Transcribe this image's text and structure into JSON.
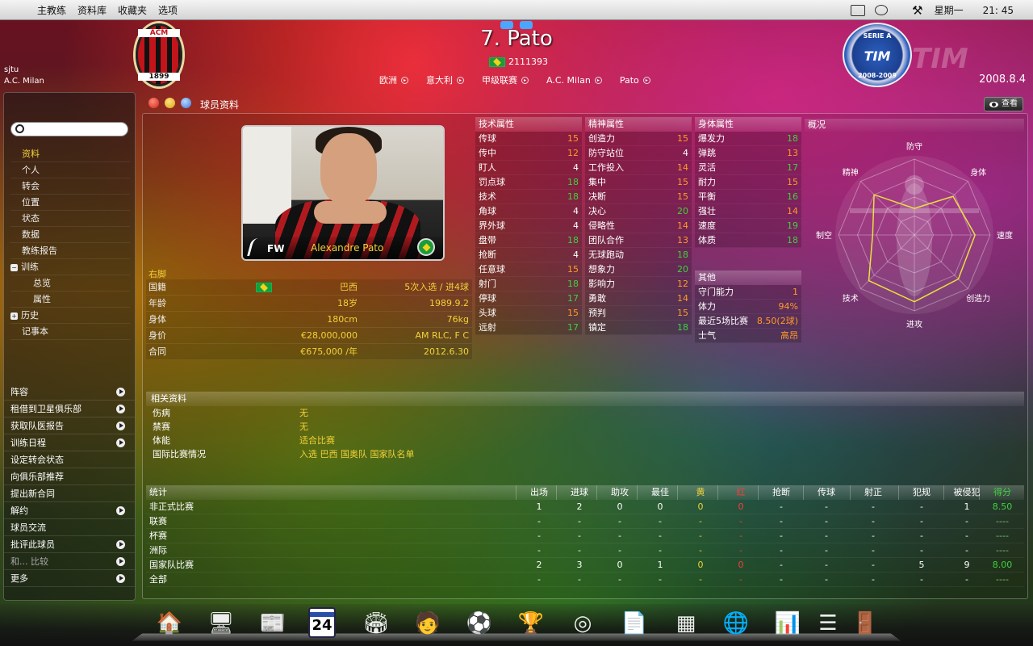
{
  "menubar": {
    "menus": [
      "主教练",
      "资料库",
      "收藏夹",
      "选项"
    ],
    "weekday": "星期一",
    "time": "21: 45"
  },
  "header": {
    "user": "sjtu",
    "club": "A.C. Milan",
    "club_logo": {
      "top": "ACM",
      "year": "1899"
    },
    "player_title": "7. Pato",
    "player_id": "2111393",
    "breadcrumbs": [
      "欧洲",
      "意大利",
      "甲级联赛",
      "A.C. Milan",
      "Pato"
    ],
    "league_logo": {
      "top": "SERIE A",
      "mid": "TIM",
      "season": "2008-2009"
    },
    "watermark": "TIM",
    "date": "2008.8.4"
  },
  "sidebar": {
    "nav": [
      {
        "label": "资料",
        "level": 1,
        "active": true
      },
      {
        "label": "个人",
        "level": 1
      },
      {
        "label": "转会",
        "level": 1
      },
      {
        "label": "位置",
        "level": 1
      },
      {
        "label": "状态",
        "level": 1
      },
      {
        "label": "数据",
        "level": 1
      },
      {
        "label": "教练报告",
        "level": 1
      },
      {
        "label": "训练",
        "level": 0,
        "toggle": "−"
      },
      {
        "label": "总览",
        "level": 2
      },
      {
        "label": "属性",
        "level": 2
      },
      {
        "label": "历史",
        "level": 0,
        "toggle": "+"
      },
      {
        "label": "记事本",
        "level": 1
      }
    ],
    "actions": [
      {
        "label": "阵容",
        "arrow": true
      },
      {
        "label": "租借到卫星俱乐部",
        "arrow": true
      },
      {
        "label": "获取队医报告",
        "arrow": true
      },
      {
        "label": "训练日程",
        "arrow": true
      },
      {
        "label": "设定转会状态",
        "arrow": false
      },
      {
        "label": "向俱乐部推荐",
        "arrow": false
      },
      {
        "label": "提出新合同",
        "arrow": false
      },
      {
        "label": "解约",
        "arrow": true
      },
      {
        "label": "球员交流",
        "arrow": false
      },
      {
        "label": "批评此球员",
        "arrow": true
      },
      {
        "label": "和... 比较",
        "arrow": true,
        "dim": true
      },
      {
        "label": "更多",
        "arrow": true
      }
    ]
  },
  "panel": {
    "title": "球员资料",
    "view_label": "查看"
  },
  "profile": {
    "position": "FW",
    "name": "Alexandre  Pato",
    "foot": "右脚",
    "bio": [
      {
        "label": "国籍",
        "flag": true,
        "mid": "巴西",
        "right": "5次入选 / 进4球"
      },
      {
        "label": "年龄",
        "mid": "18岁",
        "right": "1989.9.2"
      },
      {
        "label": "身体",
        "mid": "180cm",
        "right": "76kg"
      },
      {
        "label": "身价",
        "mid": "€28,000,000",
        "right": "AM RLC, F C"
      },
      {
        "label": "合同",
        "mid": "€675,000 /年",
        "right": "2012.6.30"
      }
    ]
  },
  "attributes": {
    "technical": {
      "title": "技术属性",
      "items": [
        {
          "name": "传球",
          "value": "15"
        },
        {
          "name": "传中",
          "value": "12"
        },
        {
          "name": "盯人",
          "value": "4"
        },
        {
          "name": "罚点球",
          "value": "18"
        },
        {
          "name": "技术",
          "value": "18"
        },
        {
          "name": "角球",
          "value": "4"
        },
        {
          "name": "界外球",
          "value": "4"
        },
        {
          "name": "盘带",
          "value": "18"
        },
        {
          "name": "抢断",
          "value": "4"
        },
        {
          "name": "任意球",
          "value": "15"
        },
        {
          "name": "射门",
          "value": "18"
        },
        {
          "name": "停球",
          "value": "17"
        },
        {
          "name": "头球",
          "value": "15"
        },
        {
          "name": "远射",
          "value": "17"
        }
      ]
    },
    "mental": {
      "title": "精神属性",
      "items": [
        {
          "name": "创造力",
          "value": "15"
        },
        {
          "name": "防守站位",
          "value": "4"
        },
        {
          "name": "工作投入",
          "value": "14"
        },
        {
          "name": "集中",
          "value": "15"
        },
        {
          "name": "决断",
          "value": "15"
        },
        {
          "name": "决心",
          "value": "20"
        },
        {
          "name": "侵略性",
          "value": "14"
        },
        {
          "name": "团队合作",
          "value": "13"
        },
        {
          "name": "无球跑动",
          "value": "18"
        },
        {
          "name": "想象力",
          "value": "20"
        },
        {
          "name": "影响力",
          "value": "12"
        },
        {
          "name": "勇敢",
          "value": "14"
        },
        {
          "name": "预判",
          "value": "15"
        },
        {
          "name": "镇定",
          "value": "18"
        }
      ]
    },
    "physical": {
      "title": "身体属性",
      "items": [
        {
          "name": "爆发力",
          "value": "18"
        },
        {
          "name": "弹跳",
          "value": "13"
        },
        {
          "name": "灵活",
          "value": "17"
        },
        {
          "name": "耐力",
          "value": "15"
        },
        {
          "name": "平衡",
          "value": "16"
        },
        {
          "name": "强壮",
          "value": "14"
        },
        {
          "name": "速度",
          "value": "19"
        },
        {
          "name": "体质",
          "value": "18"
        }
      ]
    },
    "other": {
      "title": "其他",
      "items": [
        {
          "name": "守门能力",
          "value": "1"
        },
        {
          "name": "体力",
          "value": "94%"
        },
        {
          "name": "最近5场比赛",
          "value": "8.50(2球)"
        },
        {
          "name": "士气",
          "value": "高昂"
        }
      ]
    }
  },
  "overview": {
    "title": "概况",
    "axes": [
      "防守",
      "身体",
      "速度",
      "创造力",
      "进攻",
      "技术",
      "制空",
      "精神"
    ],
    "levels": [
      0.35,
      0.72,
      0.8,
      0.82,
      0.88,
      0.85,
      0.55,
      0.75
    ]
  },
  "related": {
    "title": "相关资料",
    "rows": [
      {
        "label": "伤病",
        "value": "无"
      },
      {
        "label": "禁赛",
        "value": "无"
      },
      {
        "label": "体能",
        "value": "适合比赛"
      },
      {
        "label": "国际比赛情况",
        "value": "入选 巴西 国奥队 国家队名单"
      }
    ]
  },
  "stats": {
    "title": "统计",
    "columns": [
      "出场",
      "进球",
      "助攻",
      "最佳",
      "黄",
      "红",
      "抢断",
      "传球",
      "射正",
      "犯规",
      "被侵犯",
      "得分"
    ],
    "rows": [
      {
        "label": "非正式比赛",
        "values": [
          "1",
          "2",
          "0",
          "0",
          "0",
          "0",
          "-",
          "-",
          "-",
          "-",
          "1",
          "8.50"
        ]
      },
      {
        "label": "联赛",
        "values": [
          "-",
          "-",
          "-",
          "-",
          "-",
          "-",
          "-",
          "-",
          "-",
          "-",
          "-",
          "----"
        ]
      },
      {
        "label": "杯赛",
        "values": [
          "-",
          "-",
          "-",
          "-",
          "-",
          "-",
          "-",
          "-",
          "-",
          "-",
          "-",
          "----"
        ]
      },
      {
        "label": "洲际",
        "values": [
          "-",
          "-",
          "-",
          "-",
          "-",
          "-",
          "-",
          "-",
          "-",
          "-",
          "-",
          "----"
        ]
      },
      {
        "label": "国家队比赛",
        "values": [
          "2",
          "3",
          "0",
          "1",
          "0",
          "0",
          "-",
          "-",
          "-",
          "5",
          "9",
          "8.00"
        ]
      },
      {
        "label": "全部",
        "values": [
          "-",
          "-",
          "-",
          "-",
          "-",
          "-",
          "-",
          "-",
          "-",
          "-",
          "-",
          "----"
        ]
      }
    ]
  },
  "colors": {
    "yellow": "#f1d23a",
    "orange": "#ff9a2a",
    "green": "#40d040",
    "red": "#ff3a3a",
    "grey_green": "#7fbf7f"
  },
  "dock": {
    "icons": [
      "home-icon",
      "finder-icon",
      "newspaper-icon",
      "calendar-icon",
      "stadium-icon",
      "manager-icon",
      "ball-icon",
      "trophy-icon",
      "radar-icon",
      "document-icon",
      "tactics-board-icon",
      "globe-icon",
      "finance-icon",
      "ladder-icon",
      "exit-door-icon"
    ],
    "calendar_day": "24"
  }
}
